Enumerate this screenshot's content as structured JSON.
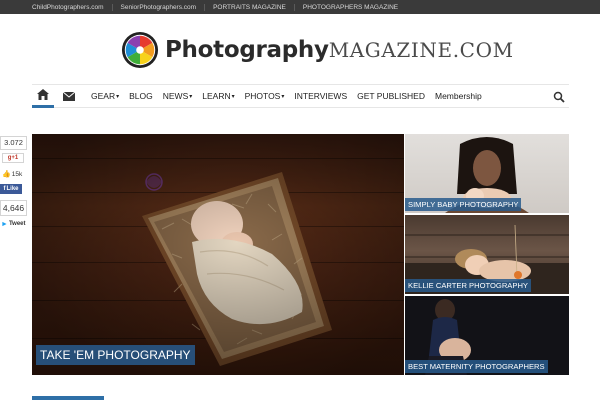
{
  "topbar": {
    "links": [
      "ChildPhotographers.com",
      "SeniorPhotographers.com",
      "PORTRAITS MAGAZINE",
      "PHOTOGRAPHERS MAGAZINE"
    ]
  },
  "logo": {
    "bold": "Photography",
    "light": "Magazine.com"
  },
  "nav": {
    "home_icon": "home-icon",
    "mail_icon": "envelope-icon",
    "items": [
      {
        "label": "GEAR",
        "dropdown": true
      },
      {
        "label": "BLOG",
        "dropdown": false
      },
      {
        "label": "NEWS",
        "dropdown": true
      },
      {
        "label": "LEARN",
        "dropdown": true
      },
      {
        "label": "PHOTOS",
        "dropdown": true
      },
      {
        "label": "INTERVIEWS",
        "dropdown": false
      },
      {
        "label": "GET PUBLISHED",
        "dropdown": false
      },
      {
        "label": "Membership",
        "dropdown": false
      }
    ],
    "search_icon": "search-icon",
    "active_color": "#2e6fa7"
  },
  "social": {
    "pinterest_count": "3.072",
    "gplus_label": "+1",
    "like_count": "15k",
    "like_label": "Like",
    "share_count": "4,646",
    "tweet_label": "Tweet"
  },
  "features": {
    "main": {
      "caption": "TAKE 'EM PHOTOGRAPHY"
    },
    "side": [
      {
        "caption": "SIMPLY BABY PHOTOGRAPHY"
      },
      {
        "caption": "KELLIE CARTER PHOTOGRAPHY"
      },
      {
        "caption": "BEST MATERNITY PHOTOGRAPHERS"
      }
    ]
  }
}
